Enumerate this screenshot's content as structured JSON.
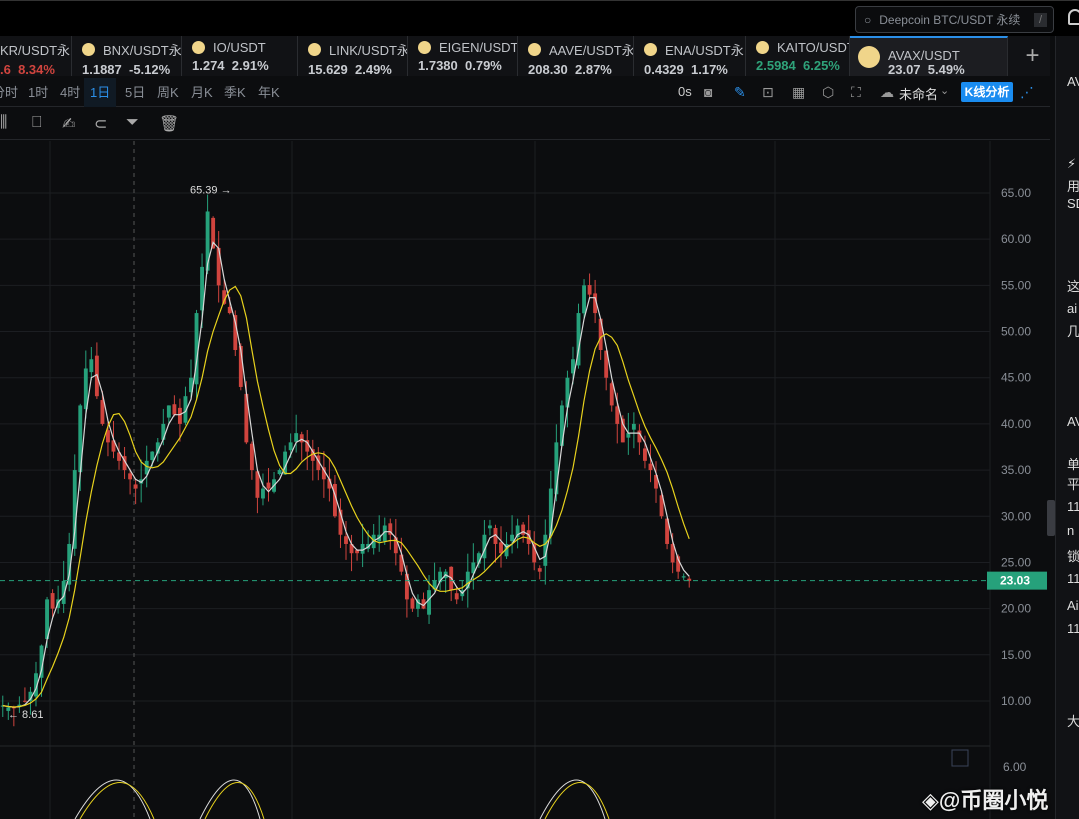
{
  "search": {
    "placeholder": "Deepcoin BTC/USDT 永续",
    "shortcut": "/"
  },
  "tickers": [
    {
      "name": "KR/USDT永",
      "price": ".6",
      "change": "8.34%",
      "dir": "dn"
    },
    {
      "name": "BNX/USDT永",
      "price": "1.1887",
      "change": "-5.12%",
      "dir": ""
    },
    {
      "name": "IO/USDT",
      "price": "1.274",
      "change": "2.91%",
      "dir": ""
    },
    {
      "name": "LINK/USDT永",
      "price": "15.629",
      "change": "2.49%",
      "dir": ""
    },
    {
      "name": "EIGEN/USDT",
      "price": "1.7380",
      "change": "0.79%",
      "dir": ""
    },
    {
      "name": "AAVE/USDT永",
      "price": "208.30",
      "change": "2.87%",
      "dir": ""
    },
    {
      "name": "ENA/USDT永",
      "price": "0.4329",
      "change": "1.17%",
      "dir": ""
    },
    {
      "name": "KAITO/USDT",
      "price": "2.5984",
      "change": "6.25%",
      "dir": "up"
    },
    {
      "name": "AVAX/USDT",
      "price": "23.07",
      "change": "5.49%",
      "dir": ""
    }
  ],
  "timeframes": [
    "分时",
    "1时",
    "4时",
    "1日",
    "5日",
    "周K",
    "月K",
    "季K",
    "年K"
  ],
  "selected_timeframe": "1日",
  "toolbar": {
    "countdown": "0s",
    "layout_name": "未命名",
    "k_analysis": "K线分析"
  },
  "chart_data": {
    "type": "candlestick",
    "symbol": "AVAX/USDT",
    "yticks": [
      "65.00",
      "60.00",
      "55.00",
      "50.00",
      "45.00",
      "40.00",
      "35.00",
      "30.00",
      "25.00",
      "20.00",
      "15.00",
      "10.00"
    ],
    "ylim": [
      6,
      70
    ],
    "last_price": "23.03",
    "high_label": "65.39 →",
    "low_label": "← 8.61",
    "sub_tick": "6.00",
    "closes": [
      9.5,
      9.3,
      9.2,
      9.6,
      10,
      11,
      13,
      16,
      21,
      20,
      21,
      23,
      27,
      35,
      42,
      46,
      47,
      43,
      40,
      38,
      37,
      36,
      35,
      34,
      33,
      34,
      36,
      37,
      38,
      40,
      42,
      41,
      40,
      43,
      45,
      52,
      57,
      63,
      59,
      55,
      53,
      52,
      48,
      44,
      38,
      35,
      32,
      33,
      33,
      34,
      35,
      37,
      38,
      39,
      38,
      37,
      36,
      35,
      34,
      33,
      30,
      28,
      27,
      26,
      26,
      27,
      27,
      28,
      28,
      29,
      28,
      26,
      24,
      21,
      20,
      21,
      20,
      22,
      23,
      24,
      24,
      22,
      21,
      22,
      24,
      25,
      26,
      28,
      29,
      27,
      26,
      27,
      28,
      29,
      28,
      27,
      25,
      24,
      28,
      33,
      38,
      42,
      45,
      47,
      52,
      55,
      54,
      52,
      48,
      45,
      42,
      40,
      38,
      39,
      40,
      38,
      36,
      35,
      33,
      30,
      27,
      25,
      24,
      23.5,
      23
    ]
  },
  "sidebar": [
    "AV",
    "⚡",
    "用",
    "SD",
    "这",
    "ai",
    "几",
    "AV",
    "单",
    "平",
    "11",
    "n",
    "锁",
    "11",
    "Ai",
    "11",
    "大"
  ],
  "watermark": "◈@币圈小悦"
}
